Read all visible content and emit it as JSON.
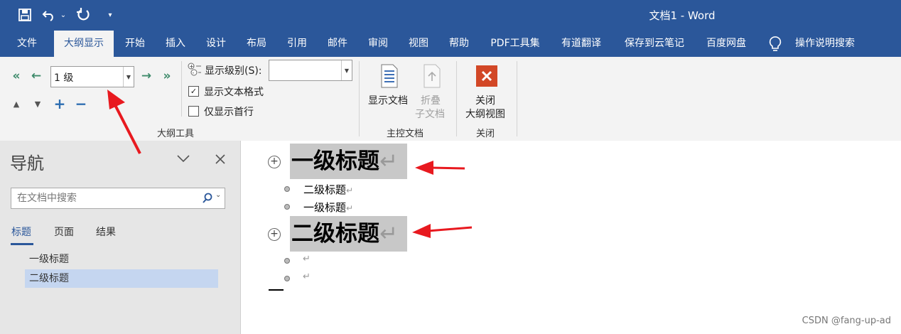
{
  "window": {
    "title": "文档1  -  Word"
  },
  "quick_access": {
    "save": "save-icon",
    "undo": "undo-icon",
    "redo": "redo-icon",
    "customize": "customize-icon"
  },
  "tabs": [
    {
      "label": "文件"
    },
    {
      "label": "大纲显示"
    },
    {
      "label": "开始"
    },
    {
      "label": "插入"
    },
    {
      "label": "设计"
    },
    {
      "label": "布局"
    },
    {
      "label": "引用"
    },
    {
      "label": "邮件"
    },
    {
      "label": "审阅"
    },
    {
      "label": "视图"
    },
    {
      "label": "帮助"
    },
    {
      "label": "PDF工具集"
    },
    {
      "label": "有道翻译"
    },
    {
      "label": "保存到云笔记"
    },
    {
      "label": "百度网盘"
    }
  ],
  "tell_me": {
    "label": "操作说明搜索"
  },
  "ribbon": {
    "outline_tools": {
      "level_value": "1 级",
      "show_level_label": "显示级别(S):",
      "show_level_value": "",
      "show_text_format": "显示文本格式",
      "show_first_line_only": "仅显示首行",
      "group_label": "大纲工具"
    },
    "master_doc": {
      "show_doc": "显示文档",
      "collapse_line1": "折叠",
      "collapse_line2": "子文档",
      "group_label": "主控文档"
    },
    "close": {
      "line1": "关闭",
      "line2": "大纲视图",
      "group_label": "关闭"
    }
  },
  "nav": {
    "title": "导航",
    "search_placeholder": "在文档中搜索",
    "tabs": [
      {
        "label": "标题"
      },
      {
        "label": "页面"
      },
      {
        "label": "结果"
      }
    ],
    "items": [
      {
        "label": "一级标题"
      },
      {
        "label": "二级标题"
      }
    ]
  },
  "document": {
    "heading1": "一级标题",
    "sub1": "二级标题",
    "sub2": "一级标题",
    "heading2": "二级标题",
    "para_mark": "↵"
  },
  "watermark": "CSDN @fang-up-ad",
  "colors": {
    "title_bar": "#2b579a",
    "ribbon": "#f3f3f3",
    "nav_pane": "#e6e6e6",
    "selected_nav": "#c5d6f0",
    "heading_highlight": "#c8c8c8",
    "arrow": "#e8191f",
    "close_button": "#d24726"
  }
}
